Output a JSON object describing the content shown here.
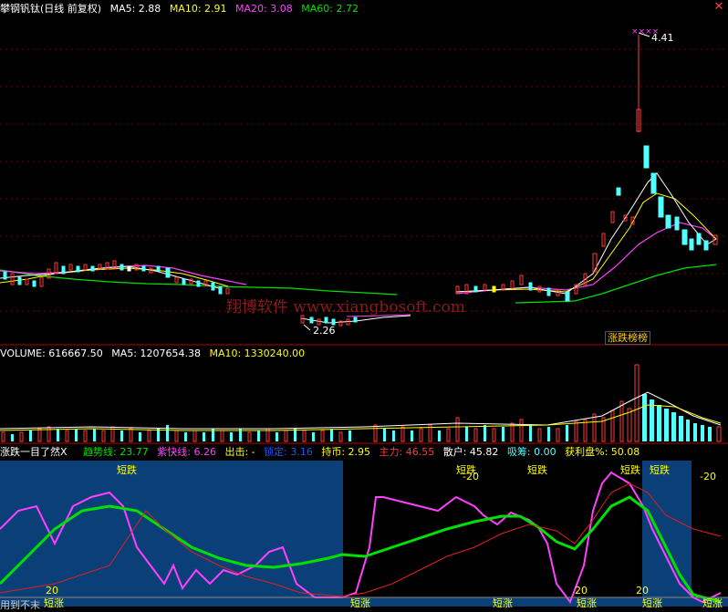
{
  "header": {
    "title": "攀钢钒钛(日线 前复权)",
    "ma5": "MA5: 2.88",
    "ma10": "MA10: 2.91",
    "ma20": "MA20: 3.08",
    "ma60": "MA60: 2.72",
    "close_icon": "close-icon"
  },
  "price_panel": {
    "high_label": "4.41",
    "low_label": "2.26",
    "watermark": "翔博软件 www.xiangbosoft.com",
    "tag": "涨跌榜榜"
  },
  "volume_panel": {
    "volume": "VOLUME: 616667.50",
    "ma5": "MA5: 1207654.38",
    "ma10": "MA10: 1330240.00"
  },
  "indicator_panel": {
    "name": "涨跌一目了然X",
    "trend": "趋势线: 23.77",
    "purple": "紫快线: 6.26",
    "out": "出击: -",
    "lock": "锁定: 3.16",
    "hold": "持币: 2.95",
    "main": "主力: 46.55",
    "retail": "散户: 45.82",
    "absorb": "吸筹: 0.00",
    "profit": "获利盘%: 50.08",
    "short_down": "短跌",
    "short_up": "短涨",
    "minus20": "-20",
    "v20": "20",
    "footer": "用到不末"
  },
  "colors": {
    "background": "#000000",
    "grid": "#800000",
    "up": "#ff3a3a",
    "down": "#54ffff",
    "ma5": "#ffffff",
    "ma10": "#ffff00",
    "ma20": "#ff40ff",
    "ma60": "#00e000",
    "blue_region": "#0b3f78"
  }
}
